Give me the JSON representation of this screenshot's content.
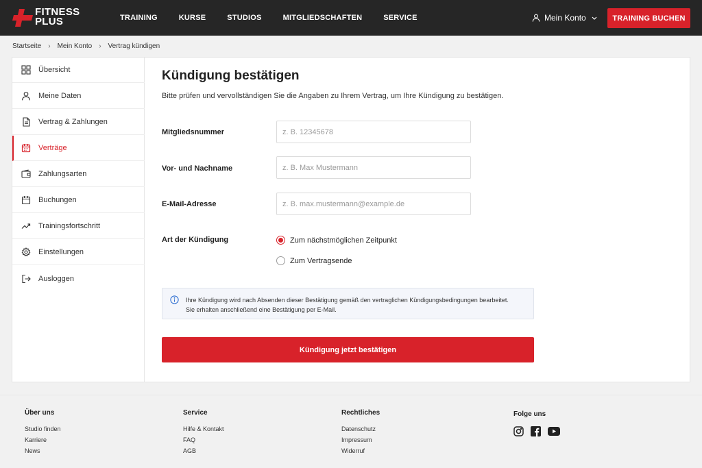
{
  "brand": {
    "line1": "FITNESS",
    "line2": "PLUS",
    "accent": "#d8222a"
  },
  "nav": [
    "TRAINING",
    "KURSE",
    "STUDIOS",
    "MITGLIEDSCHAFTEN",
    "SERVICE"
  ],
  "account": {
    "label": "Mein Konto",
    "icon": "user-icon"
  },
  "book_button": "TRAINING BUCHEN",
  "breadcrumb": [
    "Startseite",
    "Mein Konto",
    "Vertrag kündigen"
  ],
  "sidebar": {
    "items": [
      {
        "label": "Übersicht",
        "icon": "grid-icon"
      },
      {
        "label": "Meine Daten",
        "icon": "user-icon"
      },
      {
        "label": "Vertrag & Zahlungen",
        "icon": "document-icon"
      },
      {
        "label": "Verträge",
        "icon": "calendar-icon",
        "active": true
      },
      {
        "label": "Zahlungsarten",
        "icon": "wallet-icon"
      },
      {
        "label": "Buchungen",
        "icon": "calendar-icon"
      },
      {
        "label": "Trainingsfortschritt",
        "icon": "trend-icon"
      },
      {
        "label": "Einstellungen",
        "icon": "gear-icon"
      },
      {
        "label": "Ausloggen",
        "icon": "logout-icon"
      }
    ]
  },
  "main": {
    "title": "Kündigung bestätigen",
    "subtitle": "Bitte prüfen und vervollständigen Sie die Angaben zu Ihrem Vertrag, um Ihre Kündigung zu bestätigen.",
    "fields": [
      {
        "label": "Mitgliedsnummer",
        "placeholder": "z. B. 12345678",
        "value": ""
      },
      {
        "label": "Vor- und Nachname",
        "placeholder": "z. B. Max Mustermann",
        "value": ""
      },
      {
        "label": "E-Mail-Adresse",
        "placeholder": "z. B. max.mustermann@example.de",
        "value": ""
      }
    ],
    "termination_type": {
      "label": "Art der Kündigung",
      "options": [
        "Zum nächstmöglichen Zeitpunkt",
        "Zum Vertragsende"
      ],
      "selected": "Zum nächstmöglichen Zeitpunkt"
    },
    "info": {
      "line1": "Ihre Kündigung wird nach Absenden dieser Bestätigung gemäß den vertraglichen Kündigungsbedingungen bearbeitet.",
      "line2": "Sie erhalten anschließend eine Bestätigung per E-Mail."
    },
    "confirm_label": "Kündigung jetzt bestätigen"
  },
  "footer": {
    "about": {
      "title": "Über uns",
      "links": [
        "Studio finden",
        "Karriere",
        "News"
      ]
    },
    "service": {
      "title": "Service",
      "links": [
        "Hilfe & Kontakt",
        "FAQ",
        "AGB"
      ]
    },
    "legal": {
      "title": "Rechtliches",
      "links": [
        "Datenschutz",
        "Impressum",
        "Widerruf"
      ]
    },
    "social": {
      "title": "Folge uns",
      "icons": [
        "instagram-icon",
        "facebook-icon",
        "youtube-icon"
      ]
    }
  }
}
